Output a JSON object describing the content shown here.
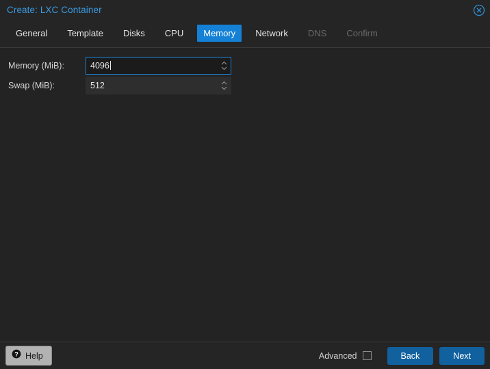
{
  "window": {
    "title": "Create: LXC Container",
    "close_icon": "close-circle-icon"
  },
  "tabs": [
    {
      "label": "General",
      "state": "enabled"
    },
    {
      "label": "Template",
      "state": "enabled"
    },
    {
      "label": "Disks",
      "state": "enabled"
    },
    {
      "label": "CPU",
      "state": "enabled"
    },
    {
      "label": "Memory",
      "state": "active"
    },
    {
      "label": "Network",
      "state": "enabled"
    },
    {
      "label": "DNS",
      "state": "disabled"
    },
    {
      "label": "Confirm",
      "state": "disabled"
    }
  ],
  "form": {
    "memory": {
      "label": "Memory (MiB):",
      "value": "4096",
      "placeholder": "",
      "focused": true,
      "spinner_icon": "spinner-up-down-icon"
    },
    "swap": {
      "label": "Swap (MiB):",
      "value": "512",
      "placeholder": "",
      "focused": false,
      "spinner_icon": "spinner-up-down-icon"
    }
  },
  "footer": {
    "help_label": "Help",
    "help_icon": "question-circle-icon",
    "advanced_label": "Advanced",
    "advanced_checked": false,
    "back_label": "Back",
    "next_label": "Next"
  },
  "colors": {
    "accent": "#1481d6",
    "button": "#11619f",
    "title": "#3a9ae0",
    "background": "#232323",
    "chrome": "#252525",
    "disabled_text": "#6a6a6a"
  }
}
